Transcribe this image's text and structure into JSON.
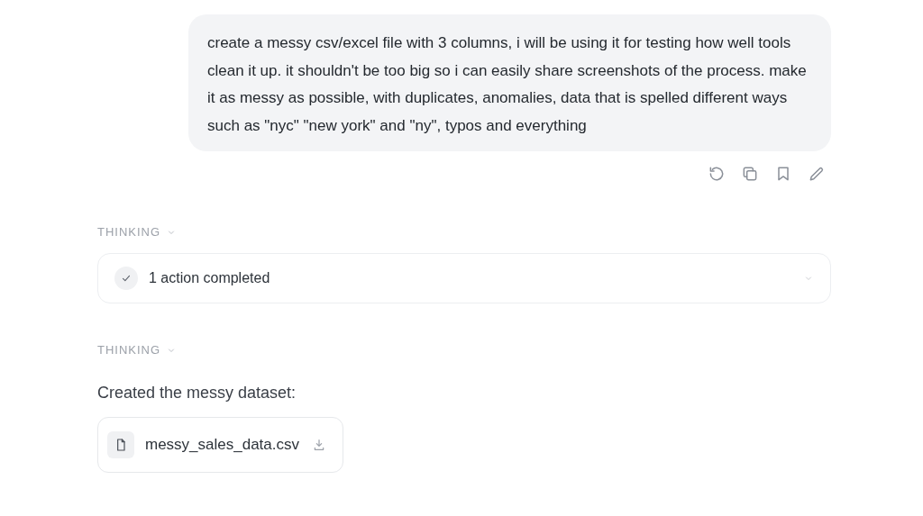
{
  "user_message": {
    "text": "create a messy csv/excel file with 3 columns, i will be using it for testing how well tools clean it up. it shouldn't be too big so i can easily share screenshots of the process. make it as messy as possible, with duplicates, anomalies, data that is spelled different ways such as \"nyc\" \"new york\" and \"ny\", typos and everything"
  },
  "message_actions": [
    {
      "kind": "retry"
    },
    {
      "kind": "copy"
    },
    {
      "kind": "bookmark"
    },
    {
      "kind": "edit"
    }
  ],
  "thinking_sections": [
    {
      "label": "THINKING",
      "expanded": false,
      "action": {
        "text": "1 action completed",
        "expanded": false
      }
    },
    {
      "label": "THINKING",
      "expanded": false
    }
  ],
  "reply": {
    "text": "Created the messy dataset:",
    "file": {
      "name": "messy_sales_data.csv"
    }
  }
}
